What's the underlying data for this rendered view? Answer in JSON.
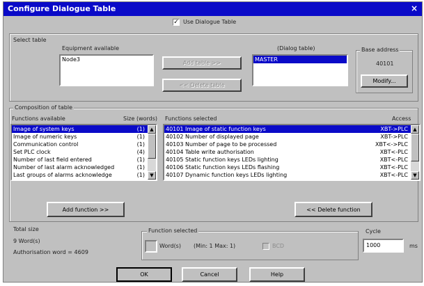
{
  "window": {
    "title": "Configure Dialogue Table",
    "close_glyph": "×"
  },
  "use_dialogue_table": {
    "label": "Use Dialogue Table",
    "checked_glyph": "✓"
  },
  "select_table": {
    "group_label": "Select table",
    "equipment_label": "Equipment available",
    "equipment_items": [
      "Node3"
    ],
    "add_button": "Add table >>",
    "delete_button": "<< Delete table",
    "dialog_table_label": "(Dialog table)",
    "dialog_table_items": [
      "MASTER"
    ],
    "base_address_label": "Base address",
    "base_address_value": "40101",
    "modify_button": "Modify..."
  },
  "composition": {
    "group_label": "Composition of table",
    "functions_available_label": "Functions available",
    "size_label": "Size (words)",
    "functions_selected_label": "Functions selected",
    "access_label": "Access",
    "available": [
      {
        "name": "Image of system keys",
        "size": "(1)"
      },
      {
        "name": "Image of numeric keys",
        "size": "(1)"
      },
      {
        "name": "Communication control",
        "size": "(1)"
      },
      {
        "name": "Set PLC clock",
        "size": "(4)"
      },
      {
        "name": "Number of last field entered",
        "size": "(1)"
      },
      {
        "name": "Number of last alarm acknowledged",
        "size": "(1)"
      },
      {
        "name": "Last groups of alarms acknowledge",
        "size": "(1)"
      }
    ],
    "selected": [
      {
        "name": "40101 Image of static function keys",
        "access": "XBT->PLC"
      },
      {
        "name": "40102 Number of displayed page",
        "access": "XBT->PLC"
      },
      {
        "name": "40103 Number of page to be processed",
        "access": "XBT<->PLC"
      },
      {
        "name": "40104 Table write authorisation",
        "access": "XBT<-PLC"
      },
      {
        "name": "40105 Static function keys LEDs lighting",
        "access": "XBT<-PLC"
      },
      {
        "name": "40106 Static function keys LEDs flashing",
        "access": "XBT<-PLC"
      },
      {
        "name": "40107 Dynamic function keys LEDs lighting",
        "access": "XBT<-PLC"
      }
    ],
    "add_function_button": "Add function >>",
    "delete_function_button": "<< Delete function"
  },
  "total": {
    "label": "Total size",
    "words": "9 Word(s)",
    "auth": "Authorisation word = 4609"
  },
  "function_selected": {
    "label": "Function selected",
    "words_label": "Word(s)",
    "range": "(Min: 1 Max: 1)",
    "bcd_label": "BCD"
  },
  "cycle": {
    "label": "Cycle",
    "value": "1000",
    "unit": "ms"
  },
  "footer": {
    "ok": "OK",
    "cancel": "Cancel",
    "help": "Help"
  }
}
